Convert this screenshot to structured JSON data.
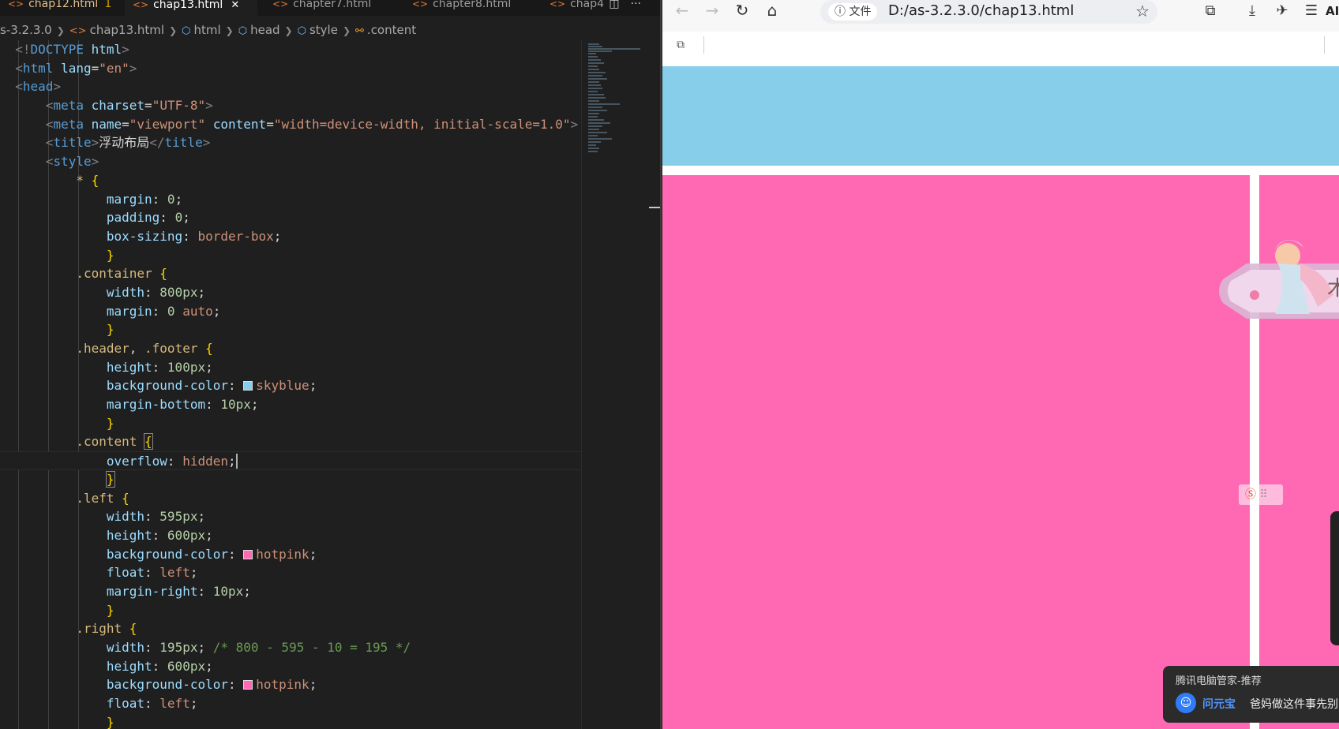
{
  "editor": {
    "tabs": [
      {
        "label": "chap12.html",
        "dirty_marker": "1"
      },
      {
        "label": "chap13.html"
      },
      {
        "label": "chapter7.html"
      },
      {
        "label": "chapter8.html"
      },
      {
        "label": "chap4"
      }
    ],
    "breadcrumb": {
      "folder": "s-3.2.3.0",
      "file": "chap13.html",
      "items": [
        "html",
        "head",
        "style",
        ".content"
      ]
    },
    "colors": {
      "skyblue": "#87ceeb",
      "hotpink": "#ff69b4"
    }
  },
  "browser": {
    "address": {
      "info_label": "文件",
      "url": "D:/as-3.2.3.0/chap13.html"
    },
    "ai_label": "AI",
    "page": {
      "header_color": "#87ceeb",
      "content_color": "#ff69b4"
    },
    "toast": {
      "title": "腾讯电脑管家-推荐",
      "bot_name": "问元宝",
      "message": "爸妈做这件事先别"
    }
  }
}
